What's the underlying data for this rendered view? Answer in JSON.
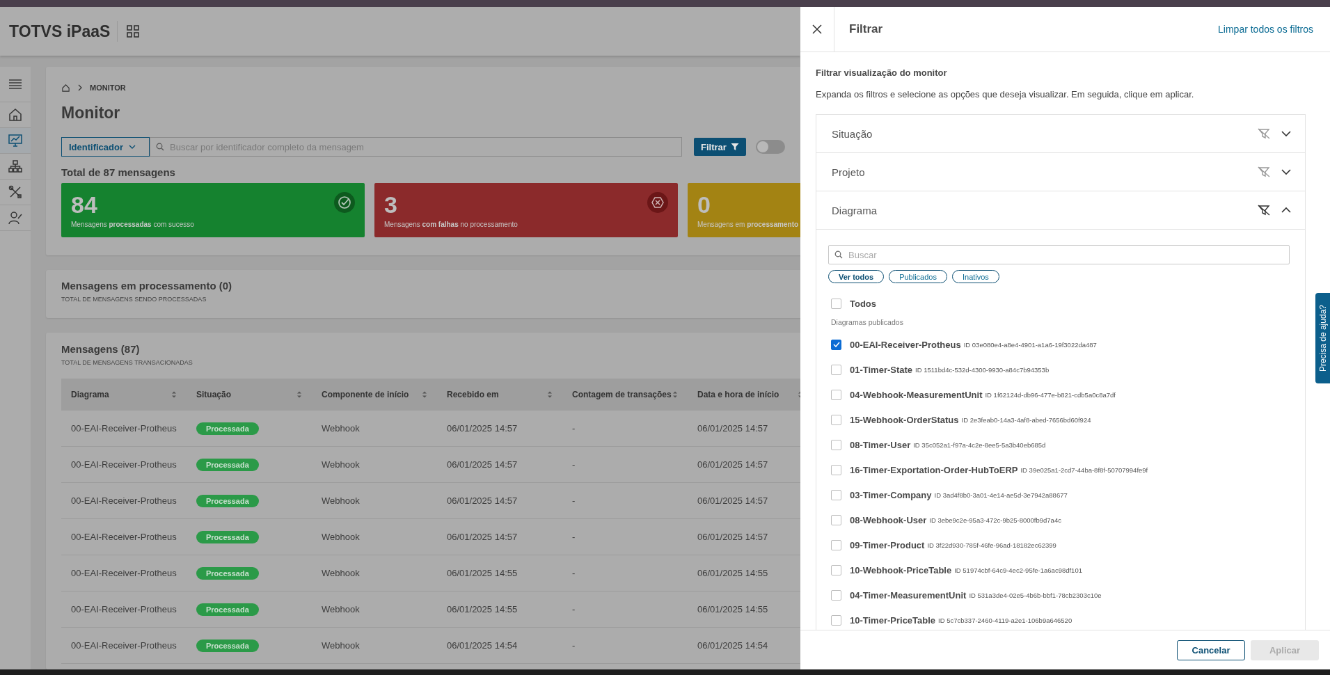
{
  "header": {
    "title": "TOTVS iPaaS"
  },
  "sidebar": {
    "items": [
      {
        "kind": "home",
        "selected": false
      },
      {
        "kind": "monitor",
        "selected": true
      },
      {
        "kind": "network",
        "selected": false
      },
      {
        "kind": "tools",
        "selected": false
      },
      {
        "kind": "users",
        "selected": false
      }
    ]
  },
  "breadcrumb": [
    "MONITOR"
  ],
  "page_title": "Monitor",
  "search": {
    "filter_type": "Identificador",
    "placeholder": "Buscar por identificador completo da mensagem",
    "filter_button": "Filtrar",
    "toggle_on": false
  },
  "total": "Total de 87 mensagens",
  "stats": [
    {
      "kind": "success",
      "value": "84",
      "caption": "Mensagens **processadas** com sucesso",
      "color": "#15822f"
    },
    {
      "kind": "error",
      "value": "3",
      "caption": "Mensagens **com falhas** no processamento",
      "color": "#8b2a2b"
    },
    {
      "kind": "pending",
      "value": "0",
      "caption": "Mensagens em **processamento**",
      "color": "#a38313"
    }
  ],
  "processing_card": {
    "title": "Mensagens em processamento (0)",
    "subtitle": "TOTAL DE MENSAGENS SENDO PROCESSADAS"
  },
  "messages": {
    "title": "Mensagens (87)",
    "subtitle": "TOTAL DE MENSAGENS TRANSACIONADAS",
    "columns": [
      "Diagrama",
      "Situação",
      "Componente de início",
      "Recebido em",
      "Contagem de transações",
      "Data e hora de início"
    ],
    "rows": [
      [
        "00-EAI-Receiver-Protheus",
        "Processada",
        "Webhook",
        "06/01/2025 14:57",
        "-",
        "06/01/2025 14:57"
      ],
      [
        "00-EAI-Receiver-Protheus",
        "Processada",
        "Webhook",
        "06/01/2025 14:57",
        "-",
        "06/01/2025 14:57"
      ],
      [
        "00-EAI-Receiver-Protheus",
        "Processada",
        "Webhook",
        "06/01/2025 14:57",
        "-",
        "06/01/2025 14:57"
      ],
      [
        "00-EAI-Receiver-Protheus",
        "Processada",
        "Webhook",
        "06/01/2025 14:57",
        "-",
        "06/01/2025 14:57"
      ],
      [
        "00-EAI-Receiver-Protheus",
        "Processada",
        "Webhook",
        "06/01/2025 14:55",
        "-",
        "06/01/2025 14:55"
      ],
      [
        "00-EAI-Receiver-Protheus",
        "Processada",
        "Webhook",
        "06/01/2025 14:55",
        "-",
        "06/01/2025 14:55"
      ],
      [
        "00-EAI-Receiver-Protheus",
        "Processada",
        "Webhook",
        "06/01/2025 14:54",
        "-",
        "06/01/2025 14:54"
      ]
    ]
  },
  "filter_panel": {
    "title": "Filtrar",
    "clear_link": "Limpar todos os filtros",
    "heading": "Filtrar visualização do monitor",
    "description": "Expanda os filtros e selecione as opções que deseja visualizar. Em seguida, clique em aplicar.",
    "sections": [
      {
        "label": "Situação",
        "expanded": false
      },
      {
        "label": "Projeto",
        "expanded": false
      },
      {
        "label": "Diagrama",
        "expanded": true
      }
    ],
    "diagram_filter": {
      "search_placeholder": "Buscar",
      "chips": [
        {
          "label": "Ver todos",
          "selected": true
        },
        {
          "label": "Publicados",
          "selected": false
        },
        {
          "label": "Inativos",
          "selected": false
        }
      ],
      "all": {
        "label": "Todos",
        "checked": false
      },
      "group_label": "Diagramas publicados",
      "options": [
        {
          "name": "00-EAI-Receiver-Protheus",
          "id": "ID 03e080e4-a8e4-4901-a1a6-19f3022da487",
          "checked": true
        },
        {
          "name": "01-Timer-State",
          "id": "ID 1511bd4c-532d-4300-9930-a84c7b94353b",
          "checked": false
        },
        {
          "name": "04-Webhook-MeasurementUnit",
          "id": "ID 1f62124d-db96-477e-b821-cdb5a0c8a7df",
          "checked": false
        },
        {
          "name": "15-Webhook-OrderStatus",
          "id": "ID 2e3feab0-14a3-4af8-abed-7656bd60f924",
          "checked": false
        },
        {
          "name": "08-Timer-User",
          "id": "ID 35c052a1-f97a-4c2e-8ee5-5a3b40eb685d",
          "checked": false
        },
        {
          "name": "16-Timer-Exportation-Order-HubToERP",
          "id": "ID 39e025a1-2cd7-44ba-8f8f-50707994fe9f",
          "checked": false
        },
        {
          "name": "03-Timer-Company",
          "id": "ID 3ad4f8b0-3a01-4e14-ae5d-3e7942a88677",
          "checked": false
        },
        {
          "name": "08-Webhook-User",
          "id": "ID 3ebe9c2e-95a3-472c-9b25-8000fb9d7a4c",
          "checked": false
        },
        {
          "name": "09-Timer-Product",
          "id": "ID 3f22d930-785f-46fe-96ad-18182ec62399",
          "checked": false
        },
        {
          "name": "10-Webhook-PriceTable",
          "id": "ID 51974cbf-64c9-4ec2-95fe-1a6ac98df101",
          "checked": false
        },
        {
          "name": "04-Timer-MeasurementUnit",
          "id": "ID 531a3de4-02e5-4b6b-bbf1-78cb2303c10e",
          "checked": false
        },
        {
          "name": "10-Timer-PriceTable",
          "id": "ID 5c7cb337-2460-4119-a2e1-106b9a646520",
          "checked": false
        }
      ]
    },
    "cancel_button": "Cancelar",
    "apply_button": "Aplicar",
    "apply_disabled": true
  },
  "help_tab": "Precisa de ajuda?"
}
